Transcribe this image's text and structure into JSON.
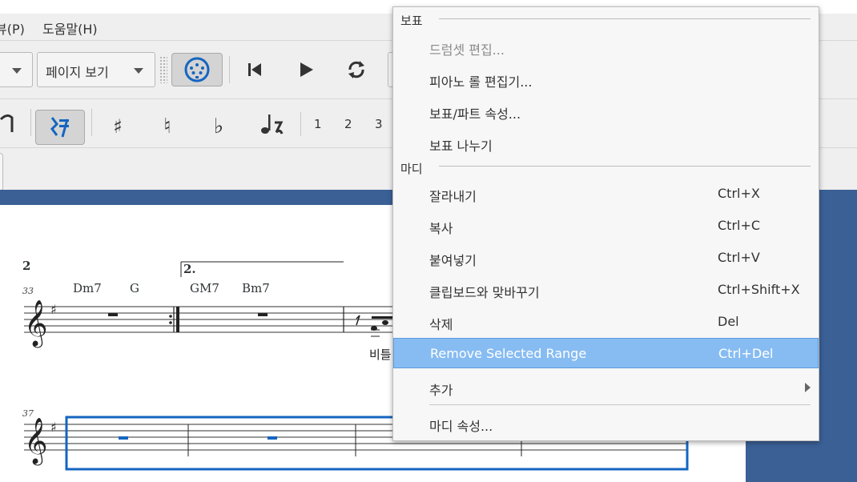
{
  "menubar": {
    "items": [
      "뷰(P)",
      "도움말(H)"
    ]
  },
  "toolbar": {
    "view_mode": "페이지 보기",
    "voices": [
      "1",
      "2",
      "3"
    ]
  },
  "score": {
    "volta_number": "2",
    "volta_label": "2.",
    "measure_33": "33",
    "measure_37": "37",
    "chords": [
      "Dm7",
      "G",
      "GM7",
      "Bm7"
    ],
    "lyric_fragment": "비틀"
  },
  "context_menu": {
    "section_score": "보표",
    "score_items": [
      {
        "label": "드럼셋 편집...",
        "disabled": true
      },
      {
        "label": "피아노 롤 편집기..."
      },
      {
        "label": "보표/파트 속성..."
      },
      {
        "label": "보표 나누기"
      }
    ],
    "section_measure": "마디",
    "measure_items": [
      {
        "label": "잘라내기",
        "shortcut": "Ctrl+X"
      },
      {
        "label": "복사",
        "shortcut": "Ctrl+C"
      },
      {
        "label": "붙여넣기",
        "shortcut": "Ctrl+V"
      },
      {
        "label": "클립보드와 맞바꾸기",
        "shortcut": "Ctrl+Shift+X"
      },
      {
        "label": "삭제",
        "shortcut": "Del"
      },
      {
        "label": "Remove Selected Range",
        "shortcut": "Ctrl+Del",
        "highlighted": true
      },
      {
        "label": "추가"
      },
      {
        "label": "마디 속성..."
      }
    ]
  },
  "colors": {
    "accent": "#1565c0",
    "highlight": "#87bcf2",
    "background": "#3b6096"
  }
}
